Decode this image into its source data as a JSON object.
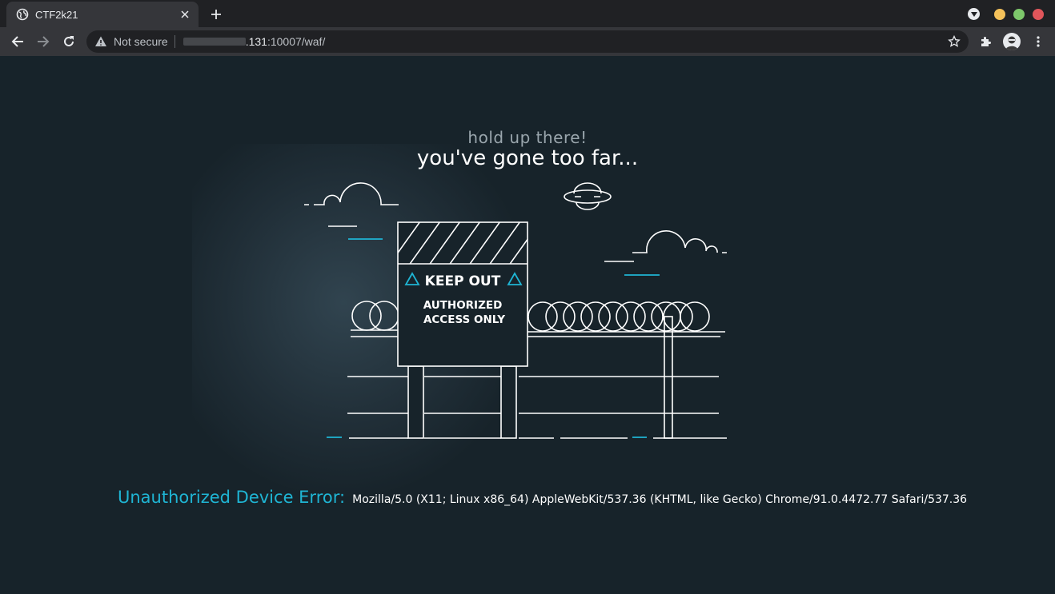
{
  "browser": {
    "tab": {
      "title": "CTF2k21"
    },
    "address_bar": {
      "security_label": "Not secure",
      "url_host": ".131",
      "url_rest": ":10007/waf/"
    },
    "window_controls": {
      "minimize_color": "#f4c15a",
      "maximize_color": "#7dc76b",
      "close_color": "#e0565b"
    }
  },
  "page": {
    "subtitle": "hold up there!",
    "headline": "you've gone too far...",
    "sign": {
      "title": "KEEP OUT",
      "line1": "AUTHORIZED",
      "line2": "ACCESS ONLY"
    },
    "error": {
      "label": "Unauthorized Device Error:",
      "user_agent": "Mozilla/5.0 (X11; Linux x86_64) AppleWebKit/537.36 (KHTML, like Gecko) Chrome/91.0.4472.77 Safari/537.36"
    }
  },
  "colors": {
    "accent": "#1fb5d4",
    "background": "#17232a",
    "chrome": "#35363a"
  }
}
